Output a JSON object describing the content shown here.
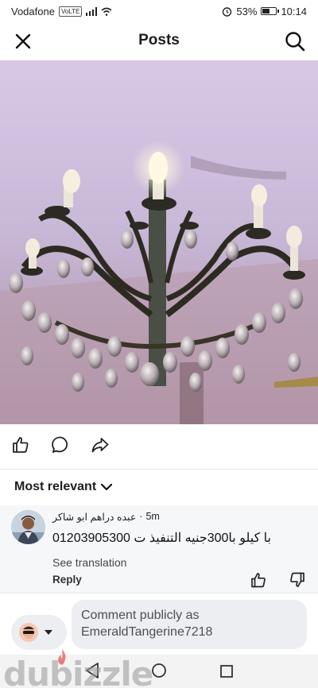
{
  "status_bar": {
    "carrier": "Vodafone",
    "volte": "VoLTE",
    "battery": "53%",
    "battery_level": 0.53,
    "time": "10:14"
  },
  "header": {
    "title": "Posts"
  },
  "post": {
    "image_alt": "Chandelier"
  },
  "sort": {
    "label": "Most relevant"
  },
  "comment": {
    "author": "عبده دراهم ابو شاكر",
    "time": "5m",
    "text": "با كيلو با300جنيه التنفيذ ت 01203905300",
    "see_translation": "See translation",
    "reply": "Reply"
  },
  "composer": {
    "placeholder": "Comment publicly as EmeraldTangerine7218"
  },
  "watermark": {
    "text": "dubizzle"
  },
  "colors": {
    "accent": "#1877f2",
    "wall": "#c9b7d7",
    "watermark": "#969696"
  }
}
